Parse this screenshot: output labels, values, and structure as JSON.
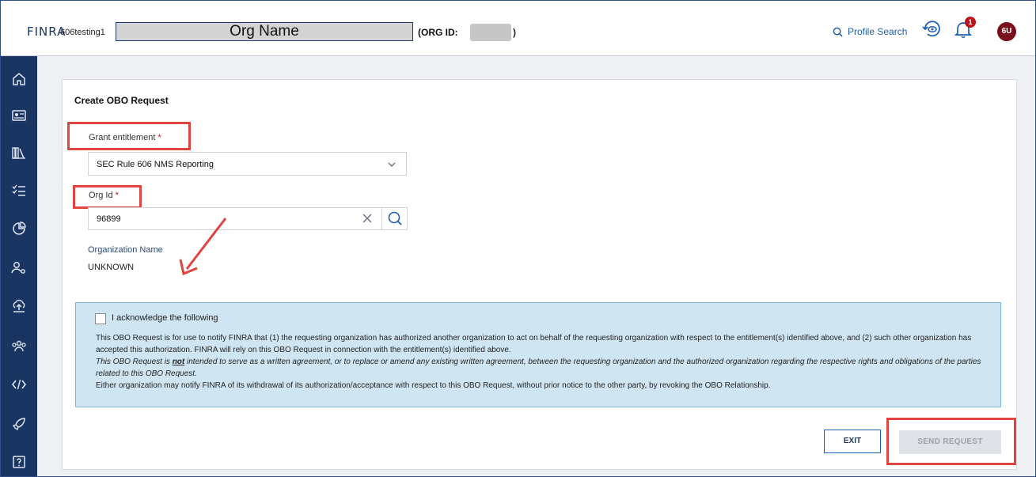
{
  "header": {
    "logo": "FINRA",
    "system_name": "606testing1",
    "org_name": "Org Name",
    "org_id_label": "(ORG ID:",
    "org_id_close": ")",
    "profile_search": "Profile Search",
    "notification_count": "1",
    "avatar_initials": "6U"
  },
  "sidebar": {
    "icons": [
      "home-icon",
      "id-card-icon",
      "library-icon",
      "checklist-icon",
      "pie-chart-icon",
      "user-settings-icon",
      "upload-icon",
      "group-icon",
      "code-icon",
      "rocket-icon",
      "help-icon"
    ]
  },
  "form": {
    "title": "Create OBO Request",
    "grant_label": "Grant entitlement",
    "required_mark": "*",
    "grant_value": "SEC Rule 606 NMS Reporting",
    "orgid_label": "Org Id",
    "orgid_value": "96899",
    "orgname_label": "Organization Name",
    "orgname_value": "UNKNOWN"
  },
  "acknowledge": {
    "checkbox_label": "I acknowledge the following",
    "para1": "This OBO Request is for use to notify FINRA that (1) the requesting organization has authorized another organization to act on behalf of the requesting organization with respect to the entitlement(s) identified above, and (2) such other organization has accepted this authorization. FINRA will rely on this OBO Request in connection with the entitlement(s) identified above.",
    "para2_a": "This OBO Request is ",
    "para2_not": "not",
    "para2_b": " intended to serve as a written agreement, or to replace or amend any existing written agreement, between the requesting organization and the authorized organization regarding the respective rights and obligations of the parties related to this OBO Request.",
    "para3": "Either organization may notify FINRA of its withdrawal of its authorization/acceptance with respect to this OBO Request, without prior notice to the other party, by revoking the OBO Relationship."
  },
  "buttons": {
    "exit": "EXIT",
    "send": "SEND REQUEST"
  },
  "colors": {
    "navy": "#1b3562",
    "accent_blue": "#1d5fb0",
    "highlight_red": "#e0443e",
    "badge_red": "#c0121b"
  }
}
